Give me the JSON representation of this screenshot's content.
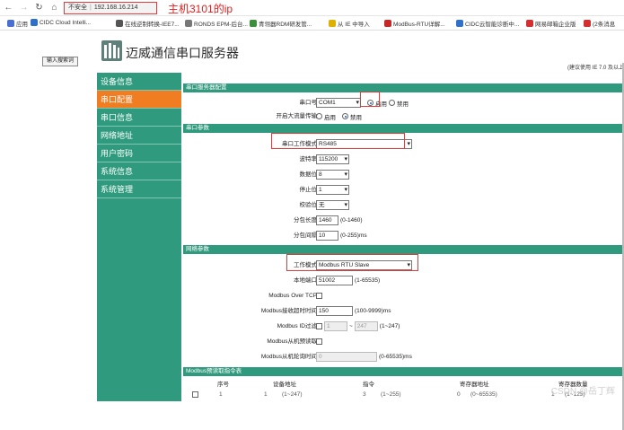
{
  "browser": {
    "security_label": "不安全",
    "url": "192.168.16.214",
    "annotation": "主机3101的ip",
    "bookmarks": [
      {
        "label": "应用",
        "color": "#4a6fd1"
      },
      {
        "label": "CIDC Cloud Intelli...",
        "color": "#2d72c8"
      },
      {
        "label": "在线逆制转换-IEE7...",
        "color": "#555555"
      },
      {
        "label": "RONDS EPM-后台...",
        "color": "#777777"
      },
      {
        "label": "青翎器RDM研发管...",
        "color": "#3c8f3c"
      },
      {
        "label": "从 IE 中导入",
        "color": "#e0b000"
      },
      {
        "label": "ModBus-RTU详解...",
        "color": "#c62828"
      },
      {
        "label": "CIDC云智能诊断中...",
        "color": "#2d72c8"
      },
      {
        "label": "网易邮箱企业版",
        "color": "#d32f2f"
      },
      {
        "label": "(2条消息",
        "color": "#d32f2f"
      }
    ]
  },
  "header": {
    "search_button": "输入搜索词",
    "brand": "迈威通信串口服务器",
    "ie_note": "(建议使用 IE 7.0 及以上"
  },
  "sidebar": {
    "items": [
      {
        "label": "设备信息",
        "active": false
      },
      {
        "label": "串口配置",
        "active": true
      },
      {
        "label": "串口信息",
        "active": false
      },
      {
        "label": "网络地址",
        "active": false
      },
      {
        "label": "用户密码",
        "active": false
      },
      {
        "label": "系统信息",
        "active": false
      },
      {
        "label": "系统管理",
        "active": false
      }
    ]
  },
  "sections": {
    "serial_config": "串口服务器配置",
    "serial_params": "串口参数",
    "network_params": "网络参数",
    "modbus_poll": "Modbus预读取指令表"
  },
  "serial_config": {
    "port_label": "串口号",
    "port_value": "COM1",
    "enable_label": "启用",
    "disable_label": "禁用",
    "bigflow_label": "开启大流量传输",
    "bigflow_on": "启用",
    "bigflow_off": "禁用"
  },
  "serial_params": {
    "mode_label": "串口工作模式",
    "mode_value": "RS485",
    "baud_label": "波特率",
    "baud_value": "115200",
    "databits_label": "数据位",
    "databits_value": "8",
    "stopbits_label": "停止位",
    "stopbits_value": "1",
    "parity_label": "校验位",
    "parity_value": "无",
    "packlen_label": "分包长度",
    "packlen_value": "1460",
    "packlen_range": "(0-1460)",
    "packint_label": "分包间隔",
    "packint_value": "10",
    "packint_range": "(0-255)ms"
  },
  "network_params": {
    "workmode_label": "工作模式",
    "workmode_value": "Modbus RTU Slave",
    "localport_label": "本地端口",
    "localport_value": "51002",
    "localport_range": "(1-65535)",
    "overtcp_label": "Modbus Over TCP",
    "timeout_label": "Modbus接收超时时间",
    "timeout_value": "150",
    "timeout_range": "(100-9999)ms",
    "idfilter_label": "Modbus ID过滤",
    "idfilter_from": "1",
    "idfilter_to": "247",
    "idfilter_tilde": "~",
    "idfilter_range": "(1~247)",
    "slaveread_label": "Modbus从机预读取",
    "slaveint_label": "Modbus从机轮询时间",
    "slaveint_value": "0",
    "slaveint_range": "(0-65535)ms"
  },
  "table": {
    "headers": [
      "序号",
      "设备地址",
      "指令",
      "寄存器地址",
      "寄存器数量"
    ],
    "row": [
      "1",
      "1",
      "(1~247)",
      "3",
      "(1~255)",
      "0",
      "(0~65535)",
      "1",
      "(1~125)"
    ]
  },
  "watermark": "CSDN @岳丁辉"
}
